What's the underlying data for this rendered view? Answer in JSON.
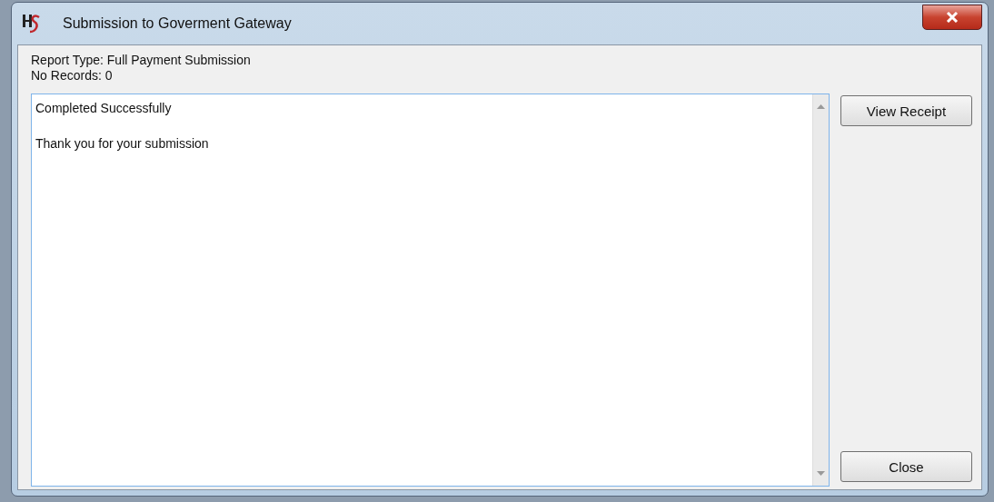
{
  "window": {
    "title": "Submission to Goverment Gateway"
  },
  "info": [
    "Report Type: Full Payment Submission",
    "No Records: 0"
  ],
  "output": {
    "lines": [
      "Completed Successfully",
      "Thank you for your submission"
    ]
  },
  "top_buttons": [
    "View Receipt"
  ],
  "bottom_buttons": [
    "Close"
  ]
}
